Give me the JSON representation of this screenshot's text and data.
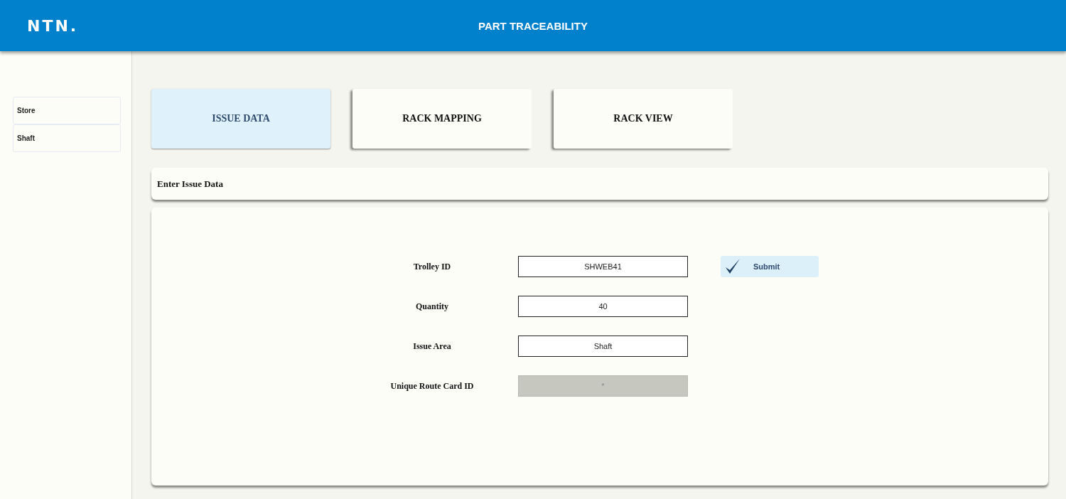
{
  "header": {
    "logo": "NTN.",
    "title": "PART TRACEABILITY"
  },
  "sidebar": {
    "items": [
      {
        "label": "Store",
        "selected": false
      },
      {
        "label": "Shaft",
        "selected": false
      }
    ]
  },
  "tabs": [
    {
      "label": "ISSUE DATA",
      "selected": true
    },
    {
      "label": "RACK MAPPING",
      "selected": false
    },
    {
      "label": "RACK VIEW",
      "selected": false
    }
  ],
  "section_title": "Enter Issue Data",
  "form": {
    "fields": [
      {
        "label": "Trolley ID",
        "value": "SHWEB41",
        "disabled": false
      },
      {
        "label": "Quantity",
        "value": "40",
        "disabled": false
      },
      {
        "label": "Issue Area",
        "value": "Shaft",
        "disabled": false
      },
      {
        "label": "Unique Route Card ID",
        "value": "*",
        "disabled": true
      }
    ],
    "submit": "Submit"
  }
}
